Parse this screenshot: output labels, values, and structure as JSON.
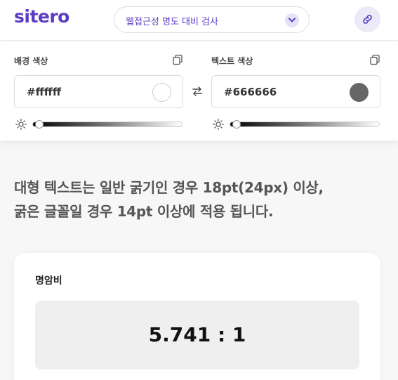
{
  "header": {
    "logo": "sitero",
    "tool_select": {
      "selected": "웹접근성 명도 대비 검사"
    },
    "icons": {
      "chevron": "chevron-down-icon",
      "link": "link-icon"
    },
    "brand_color": "#5b3cc4"
  },
  "background": {
    "label": "배경 색상",
    "value": "#ffffff",
    "swatch_color": "#ffffff",
    "brightness_level": 0.02
  },
  "text": {
    "label": "텍스트 색상",
    "value": "#666666",
    "swatch_color": "#666666",
    "brightness_level": 0.02
  },
  "notice": {
    "line1": "대형 텍스트는 일반 굵기인 경우 18pt(24px) 이상,",
    "line2": "굵은 글꼴일 경우 14pt 이상에 적용 됩니다."
  },
  "result": {
    "title": "명암비",
    "ratio": "5.741 : 1"
  }
}
